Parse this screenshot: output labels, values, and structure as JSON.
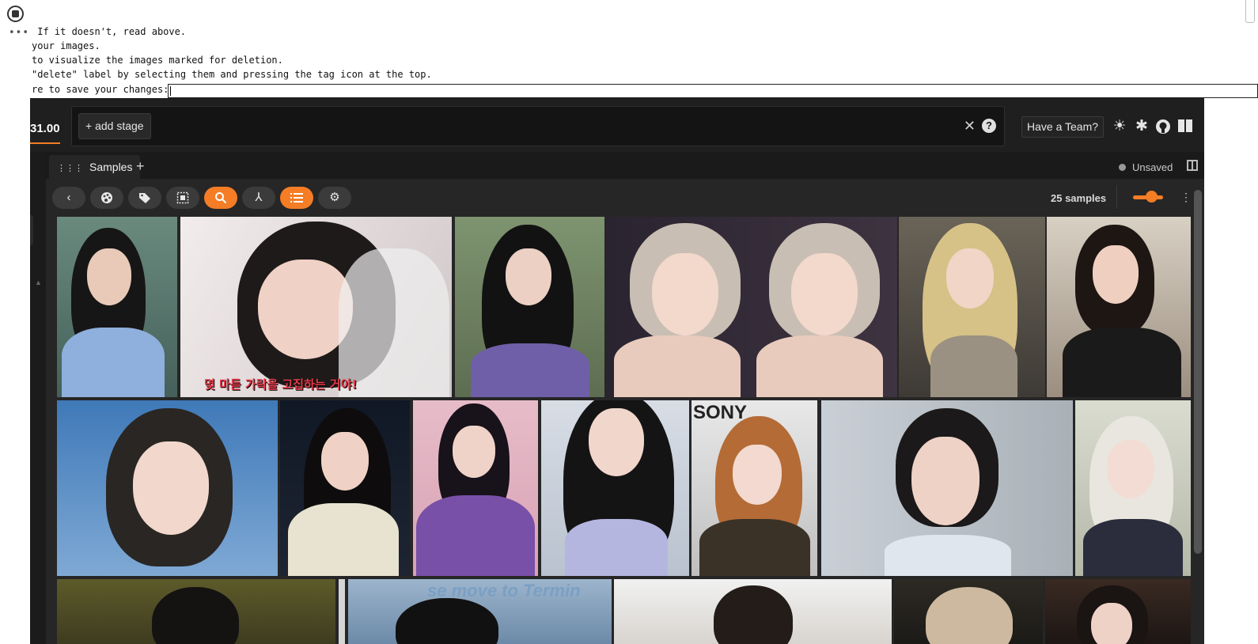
{
  "notebook": {
    "lines": [
      " If it doesn't, read above.",
      "your images.",
      "to visualize the images marked for deletion.",
      "\"delete\" label by selecting them and pressing the tag icon at the top.",
      "re to save your changes:"
    ],
    "save_input_value": ""
  },
  "app": {
    "version": "31.00",
    "add_stage_label": "+ add stage",
    "team_button": "Have a Team?",
    "tab_label": "Samples",
    "unsaved_label": "Unsaved",
    "samples_count": "25 samples",
    "slider_level": 0.6,
    "accent_color": "#f47d25",
    "header_icons": [
      "clear-x-icon",
      "help-icon",
      "sun-icon",
      "slack-icon",
      "github-icon",
      "book-icon"
    ],
    "toolbar_icons": [
      "back-icon",
      "palette-icon",
      "tag-icon",
      "select-icon",
      "search-icon",
      "merge-icon",
      "list-icon",
      "settings-icon"
    ]
  },
  "gallery": {
    "image_caption": "몇 마듣 가락을 고집하는 거야!",
    "watermarks": [
      "SONY",
      "se move to Termin"
    ]
  }
}
